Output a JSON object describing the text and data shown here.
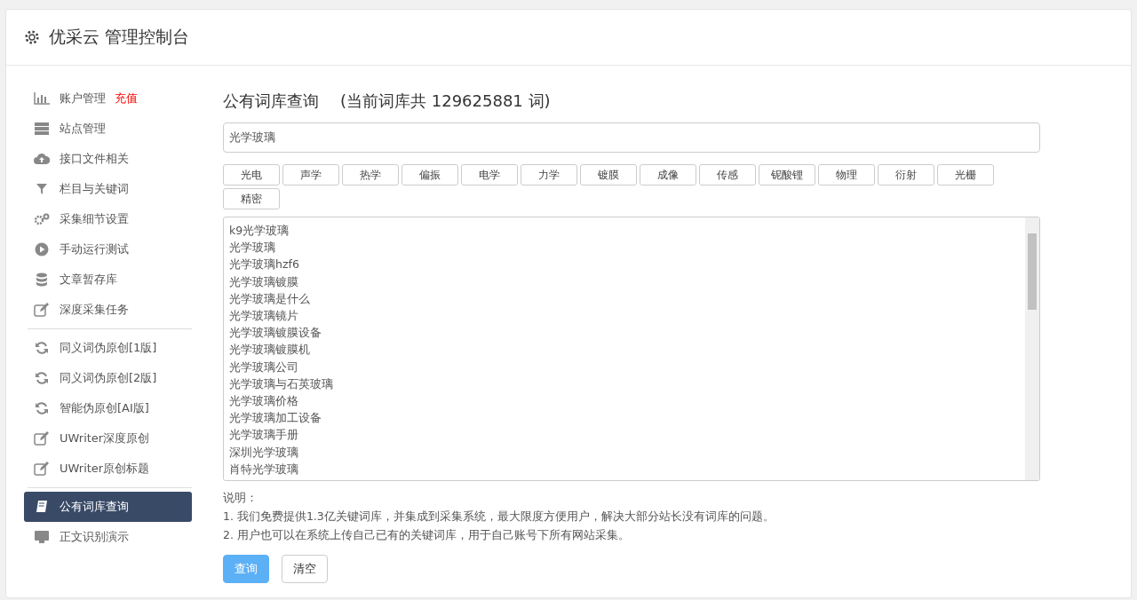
{
  "header": {
    "title": "优采云 管理控制台"
  },
  "sidebar": {
    "items": [
      {
        "label": "账户管理",
        "badge": "充值",
        "selected": false
      },
      {
        "label": "站点管理",
        "selected": false
      },
      {
        "label": "接口文件相关",
        "selected": false
      },
      {
        "label": "栏目与关键词",
        "selected": false
      },
      {
        "label": "采集细节设置",
        "selected": false
      },
      {
        "label": "手动运行测试",
        "selected": false
      },
      {
        "label": "文章暂存库",
        "selected": false
      },
      {
        "label": "深度采集任务",
        "selected": false,
        "divider_after": true
      },
      {
        "label": "同义词伪原创[1版]",
        "selected": false
      },
      {
        "label": "同义词伪原创[2版]",
        "selected": false
      },
      {
        "label": "智能伪原创[AI版]",
        "selected": false
      },
      {
        "label": "UWriter深度原创",
        "selected": false
      },
      {
        "label": "UWriter原创标题",
        "selected": false,
        "divider_after": true
      },
      {
        "label": "公有词库查询",
        "selected": true
      },
      {
        "label": "正文识别演示",
        "selected": false
      }
    ]
  },
  "main": {
    "title": "公有词库查询",
    "subtitle": "(当前词库共 129625881 词)",
    "search": {
      "value": "光学玻璃"
    },
    "tags": [
      "光电",
      "声学",
      "热学",
      "偏振",
      "电学",
      "力学",
      "镀膜",
      "成像",
      "传感",
      "铌酸锂",
      "物理",
      "衍射",
      "光栅",
      "精密"
    ],
    "results": [
      "k9光学玻璃",
      "光学玻璃",
      "光学玻璃hzf6",
      "光学玻璃镀膜",
      "光学玻璃是什么",
      "光学玻璃镜片",
      "光学玻璃镀膜设备",
      "光学玻璃镀膜机",
      "光学玻璃公司",
      "光学玻璃与石英玻璃",
      "光学玻璃价格",
      "光学玻璃加工设备",
      "光学玻璃手册",
      "深圳光学玻璃",
      "肖特光学玻璃"
    ],
    "notes_title": "说明：",
    "notes": [
      "1. 我们免费提供1.3亿关键词库，并集成到采集系统，最大限度方便用户，解决大部分站长没有词库的问题。",
      "2. 用户也可以在系统上传自己已有的关键词库，用于自己账号下所有网站采集。"
    ],
    "buttons": [
      {
        "label": "查询",
        "kind": "primary"
      },
      {
        "label": "清空",
        "kind": "default"
      }
    ]
  }
}
